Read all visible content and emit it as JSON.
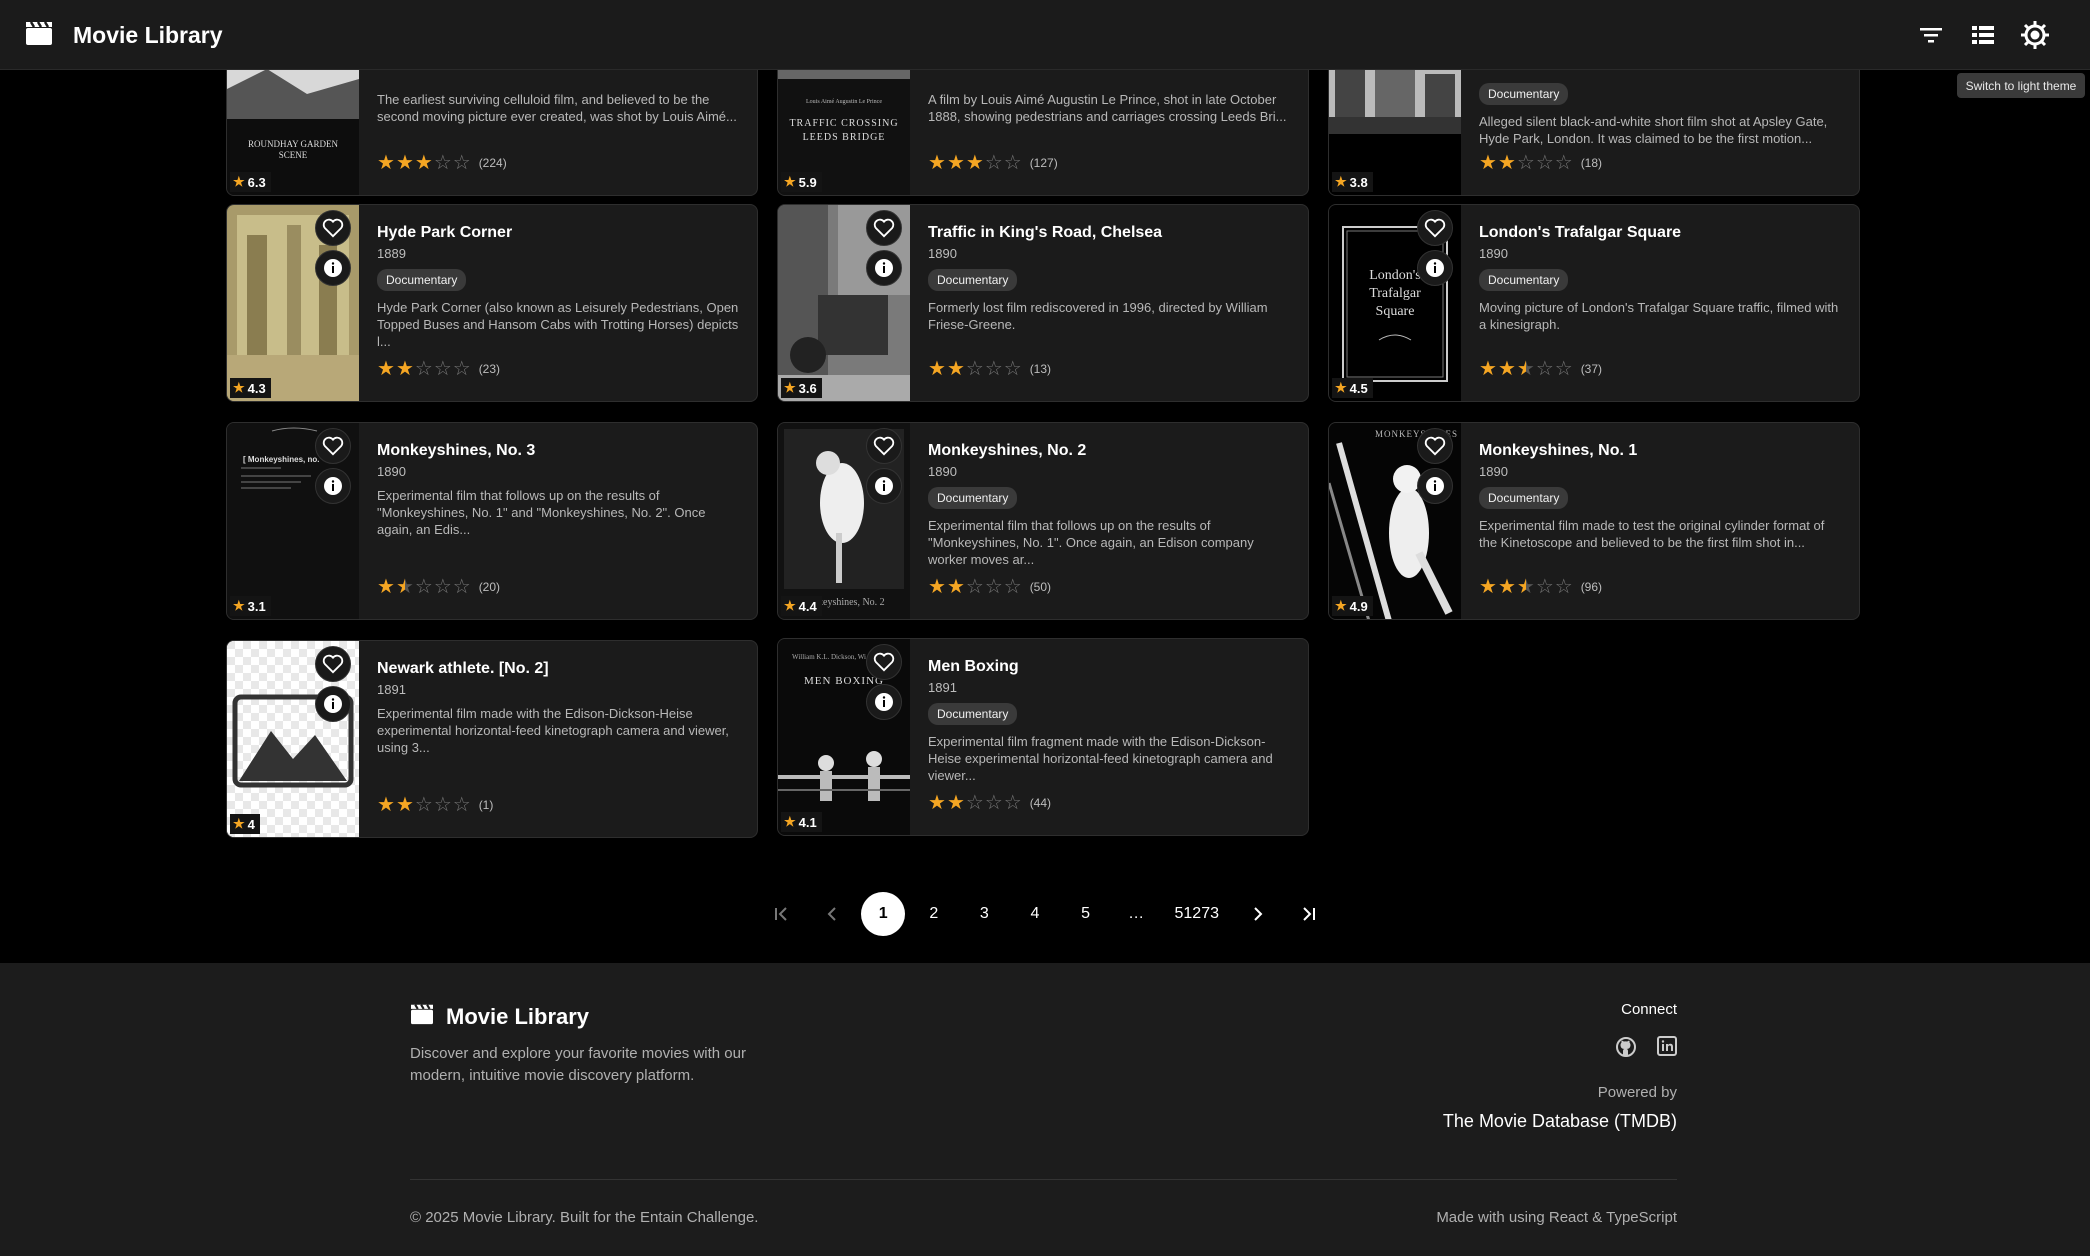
{
  "header": {
    "title": "Movie Library",
    "icons": [
      "clapperboard-icon",
      "filter-icon",
      "list-view-icon",
      "theme-toggle-icon"
    ],
    "tooltip": "Switch to light theme"
  },
  "movies": [
    {
      "title": "",
      "year": "",
      "genre": "",
      "description": "The earliest surviving celluloid film, and believed to be the second moving picture ever created, was shot by Louis Aimé...",
      "stars": 3,
      "count": "(224)",
      "rating": "6.3",
      "poster_caption": "ROUNDHAY GARDEN SCENE"
    },
    {
      "title": "",
      "year": "",
      "genre": "",
      "description": "A film by Louis Aimé Augustin Le Prince, shot in late October 1888, showing pedestrians and carriages crossing Leeds Bri...",
      "stars": 3,
      "count": "(127)",
      "rating": "5.9",
      "poster_caption": "TRAFFIC CROSSING LEEDS BRIDGE"
    },
    {
      "title": "",
      "year": "",
      "genre": "Documentary",
      "description": "Alleged silent black-and-white short film shot at Apsley Gate, Hyde Park, London. It was claimed to be the first motion...",
      "stars": 2,
      "count": "(18)",
      "rating": "3.8",
      "poster_caption": ""
    },
    {
      "title": "Hyde Park Corner",
      "year": "1889",
      "genre": "Documentary",
      "description": "Hyde Park Corner (also known as Leisurely Pedestrians, Open Topped Buses and Hansom Cabs with Trotting Horses) depicts l...",
      "stars": 2,
      "count": "(23)",
      "rating": "4.3",
      "poster_caption": ""
    },
    {
      "title": "Traffic in King's Road, Chelsea",
      "year": "1890",
      "genre": "Documentary",
      "description": "Formerly lost film rediscovered in 1996, directed by William Friese-Greene.",
      "stars": 2,
      "count": "(13)",
      "rating": "3.6",
      "poster_caption": ""
    },
    {
      "title": "London's Trafalgar Square",
      "year": "1890",
      "genre": "Documentary",
      "description": "Moving picture of London's Trafalgar Square traffic, filmed with a kinesigraph.",
      "stars": 2.5,
      "count": "(37)",
      "rating": "4.5",
      "poster_caption": "London's Trafalgar Square"
    },
    {
      "title": "Monkeyshines, No. 3",
      "year": "1890",
      "genre": "",
      "description": "Experimental film that follows up on the results of \"Monkeyshines, No. 1\" and \"Monkeyshines, No. 2\". Once again, an Edis...",
      "stars": 1.5,
      "count": "(20)",
      "rating": "3.1",
      "poster_caption": "[ Monkeyshines, no."
    },
    {
      "title": "Monkeyshines, No. 2",
      "year": "1890",
      "genre": "Documentary",
      "description": "Experimental film that follows up on the results of \"Monkeyshines, No. 1\". Once again, an Edison company worker moves ar...",
      "stars": 2,
      "count": "(50)",
      "rating": "4.4",
      "poster_caption": "keyshines, No. 2"
    },
    {
      "title": "Monkeyshines, No. 1",
      "year": "1890",
      "genre": "Documentary",
      "description": "Experimental film made to test the original cylinder format of the Kinetoscope and believed to be the first film shot in...",
      "stars": 2.5,
      "count": "(96)",
      "rating": "4.9",
      "poster_caption": "MONKEYSHINES"
    },
    {
      "title": "Newark athlete. [No. 2]",
      "year": "1891",
      "genre": "",
      "description": "Experimental film made with the Edison-Dickson-Heise experimental horizontal-feed kinetograph camera and viewer, using 3...",
      "stars": 2,
      "count": "(1)",
      "rating": "4",
      "poster_caption": ""
    },
    {
      "title": "Men Boxing",
      "year": "1891",
      "genre": "Documentary",
      "description": "Experimental film fragment made with the Edison-Dickson-Heise experimental horizontal-feed kinetograph camera and viewer...",
      "stars": 2,
      "count": "(44)",
      "rating": "4.1",
      "poster_caption": "MEN BOXING"
    }
  ],
  "pagination": {
    "pages": [
      "1",
      "2",
      "3",
      "4",
      "5",
      "…",
      "51273"
    ],
    "current": "1"
  },
  "footer": {
    "title": "Movie Library",
    "description": "Discover and explore your favorite movies with our modern, intuitive movie discovery platform.",
    "connect": "Connect",
    "powered_by": "Powered by",
    "tmdb": "The Movie Database (TMDB)",
    "copyright": "© 2025 Movie Library. Built for the Entain Challenge.",
    "made_with": "Made with using React & TypeScript"
  },
  "colors": {
    "star": "#f5a623",
    "background": "#000000",
    "card": "#1b1b1b"
  }
}
